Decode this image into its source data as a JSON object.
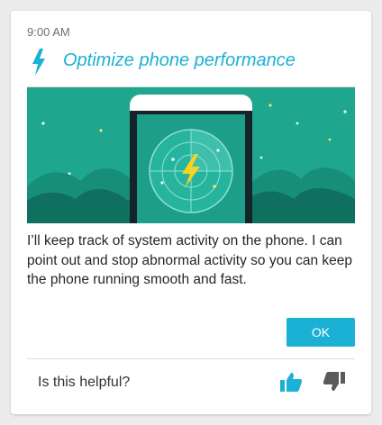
{
  "card": {
    "time": "9:00 AM",
    "title": "Optimize phone performance",
    "body": "I’ll keep track of system activity on the phone. I can point out and stop abnormal activity so you can keep the phone running smooth and fast.",
    "ok_label": "OK",
    "helpful_prompt": "Is this helpful?"
  },
  "icons": {
    "title": "lightning-bolt-icon",
    "illustration_center": "lightning-bolt-icon",
    "thumbs_up": "thumbs-up-icon",
    "thumbs_down": "thumbs-down-icon"
  },
  "colors": {
    "accent": "#1ab1d4",
    "illustration_bg": "#1fa68e",
    "bolt_yellow": "#f7d31e",
    "thumbs_down": "#5a5a5a"
  }
}
